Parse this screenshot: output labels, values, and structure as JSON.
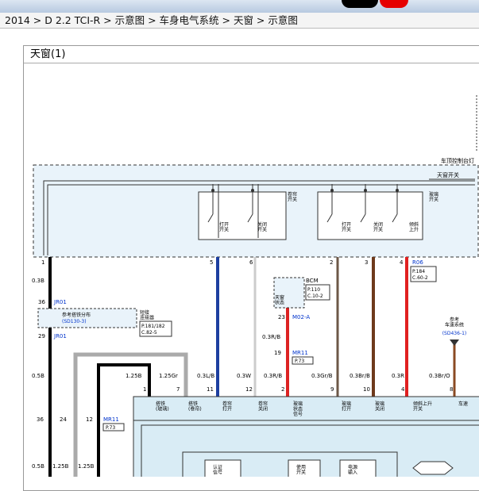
{
  "breadcrumb": "2014 > D 2.2 TCI-R > 示意图 > 车身电气系统 > 天窗 > 示意图",
  "panel_title": "天窗(1)",
  "labels": {
    "roof_console": "车顶控制台灯",
    "sunroof_switch": "天窗开关",
    "sunshade_switch": "卷帘\n开关",
    "glass_switch": "玻璃\n开关",
    "open_switch_1": "打开\n开关",
    "close_switch_1": "关闭\n开关",
    "open_switch_2": "打开\n开关",
    "close_switch_2": "关闭\n开关",
    "tilt_switch": "倾斜\n上升",
    "bcm": "BCM",
    "bcm_p": "P.110",
    "bcm_c": "C.10-2",
    "sunroof_state": "天窗\n状态",
    "connector_ref": "参考搭铁分布",
    "connector_ref_code": "(SD130-3)",
    "ground_connector": "短接\n连接器",
    "ground_p": "P.181/182",
    "ground_c": "C.82-5",
    "speed_ref_title": "参考\n车速系统",
    "speed_ref_code": "(SD436-1)",
    "r06": "R06",
    "r06_p": "P.184",
    "r06_c": "C.60-2",
    "jr01_top": "JR01",
    "jr01_bottom": "JR01",
    "m02a": "M02-A",
    "mr11": "MR11",
    "mr11_p": "P.73",
    "mr11_b": "MR11",
    "mr11_b_p": "P.73"
  },
  "pins_top": [
    "1",
    "5",
    "6",
    "2",
    "3",
    "4"
  ],
  "wires_top": [
    "0.3B",
    "0.3R/B",
    "0.3R/B",
    "0.3R/B"
  ],
  "wires_mid": [
    "0.5B",
    "1.25B",
    "1.25Gr",
    "0.3L/B",
    "0.3W",
    "0.3R/B",
    "0.3Gr/B",
    "0.3Br/B",
    "0.3R",
    "0.3Br/O"
  ],
  "pins_mid": [
    "1",
    "7",
    "11",
    "12",
    "2",
    "9",
    "10",
    "4",
    "8"
  ],
  "module_pins": [
    "搭铁\n(玻璃)",
    "搭铁\n(卷帘)",
    "卷帘\n打开",
    "卷帘\n关闭",
    "玻璃\n状态\n信号",
    "玻璃\n打开",
    "玻璃\n关闭",
    "倾斜上升\n开关",
    "车速"
  ],
  "pins_bus": [
    "36",
    "24",
    "12",
    "23",
    "19"
  ],
  "bottom_wires": [
    "0.5B",
    "1.25B",
    "1.25B"
  ],
  "inner_boxes": [
    "认证\n信号",
    "使用\n开关",
    "电源\n输入"
  ]
}
